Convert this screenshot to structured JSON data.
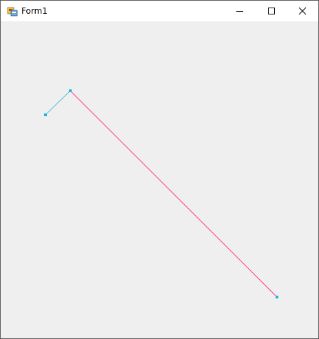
{
  "window": {
    "title": "Form1",
    "buttons": {
      "minimize": "minimize-icon",
      "maximize": "maximize-icon",
      "close": "close-icon"
    },
    "colors": {
      "client_background": "#efefef",
      "title_background": "#ffffff",
      "segment_short": "#4ec2e0",
      "segment_long": "#ff3c8c",
      "point": "#1fb4e4"
    }
  }
}
